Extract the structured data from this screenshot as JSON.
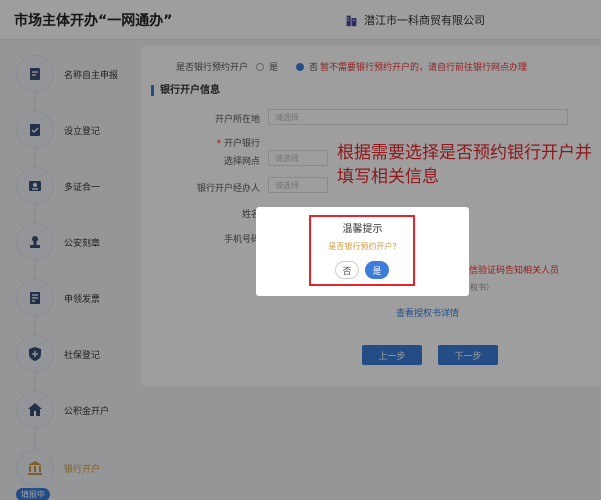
{
  "header": {
    "title": "市场主体开办“一网通办”",
    "company": "潜江市一科商贸有限公司",
    "company_icon": "building-icon"
  },
  "sidebar": {
    "steps": [
      {
        "label": "名称自主申报",
        "icon": "edit-doc-icon"
      },
      {
        "label": "设立登记",
        "icon": "form-edit-icon"
      },
      {
        "label": "多证合一",
        "icon": "certificate-icon"
      },
      {
        "label": "公安刻章",
        "icon": "seal-icon"
      },
      {
        "label": "申领发票",
        "icon": "invoice-icon"
      },
      {
        "label": "社保登记",
        "icon": "shield-icon"
      },
      {
        "label": "公积金开户",
        "icon": "fund-icon"
      },
      {
        "label": "银行开户",
        "icon": "bank-icon"
      }
    ],
    "badge": "填报中"
  },
  "form": {
    "reserve_label": "是否银行预约开户",
    "option_yes": "是",
    "option_no": "否",
    "warning": "暂不需要银行预约开户的，请自行前往银行网点办理",
    "section_title": "银行开户信息",
    "location_label": "开户所在地",
    "location_placeholder": "请选择",
    "bank_label_required": "*",
    "bank_label_1": "开户银行",
    "bank_label_2": "选择网点",
    "bank_placeholder": "请选择",
    "agent_label": "银行开户经办人",
    "agent_placeholder": "请选择",
    "name_label": "姓名",
    "phone_label": "手机号码",
    "notice": "短信验证码告知相关人员",
    "auth_hint": "权书）",
    "view_auth": "查看授权书详情",
    "prev": "上一步",
    "next": "下一步"
  },
  "annotation": "根据需要选择是否预约银行开户并填写相关信息",
  "dialog": {
    "title": "温馨提示",
    "message": "是否银行预约开户?",
    "no": "否",
    "yes": "是"
  },
  "colors": {
    "accent": "#3b7dd8",
    "warning": "#e33333",
    "annotation": "#e8262a",
    "active_step": "#d19a3a"
  }
}
